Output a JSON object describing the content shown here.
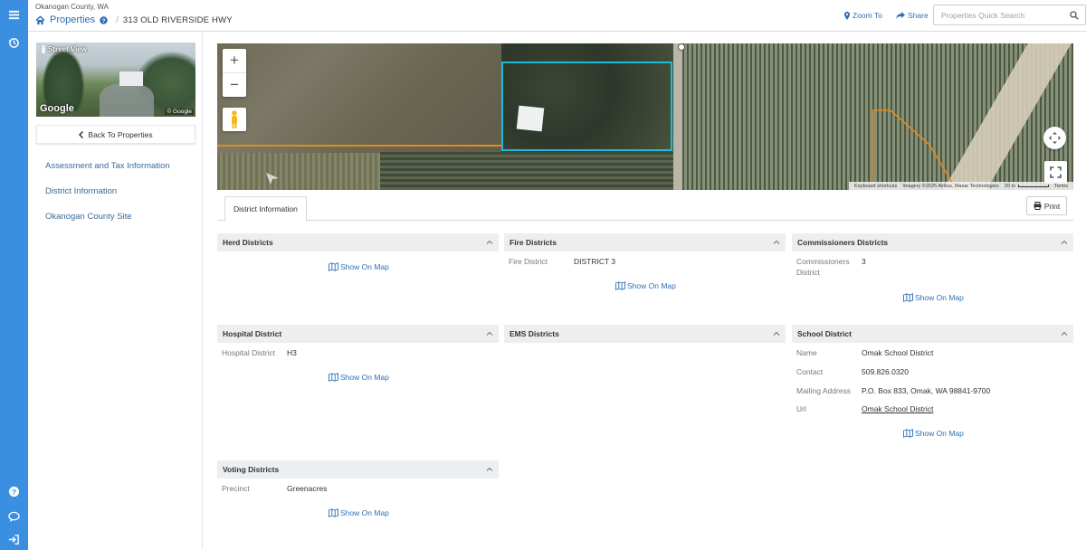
{
  "header": {
    "county": "Okanogan County, WA",
    "breadcrumb_root": "Properties",
    "address": "313 OLD RIVERSIDE HWY",
    "zoom_to": "Zoom To",
    "share": "Share",
    "search_placeholder": "Properties Quick Search"
  },
  "sidebar": {
    "street_view_label": "Street View",
    "street_view_logo": "Google",
    "street_view_copyright": "© Google",
    "back_button": "Back To Properties",
    "nav": [
      "Assessment and Tax Information",
      "District Information",
      "Okanogan County Site"
    ]
  },
  "map": {
    "attribution": {
      "shortcuts": "Keyboard shortcuts",
      "imagery": "Imagery ©2025 Airbus, Maxar Technologies",
      "scale": "20 m",
      "terms": "Terms"
    }
  },
  "tabs": {
    "active": "District Information",
    "print": "Print"
  },
  "show_on_map": "Show On Map",
  "panels": {
    "herd": {
      "title": "Herd Districts"
    },
    "fire": {
      "title": "Fire Districts",
      "rows": [
        {
          "k": "Fire District",
          "v": "DISTRICT 3"
        }
      ]
    },
    "commissioners": {
      "title": "Commissioners Districts",
      "rows": [
        {
          "k": "Commissioners District",
          "v": "3"
        }
      ]
    },
    "hospital": {
      "title": "Hospital District",
      "rows": [
        {
          "k": "Hospital District",
          "v": "H3"
        }
      ]
    },
    "ems": {
      "title": "EMS Districts"
    },
    "school": {
      "title": "School District",
      "rows": [
        {
          "k": "Name",
          "v": "Omak School District"
        },
        {
          "k": "Contact",
          "v": "509.826.0320"
        },
        {
          "k": "Mailing Address",
          "v": "P.O. Box 833, Omak, WA 98841-9700"
        },
        {
          "k": "Url",
          "v": "Omak School District"
        }
      ]
    },
    "voting": {
      "title": "Voting Districts",
      "rows": [
        {
          "k": "Precinct",
          "v": "Greenacres"
        }
      ]
    }
  },
  "colors": {
    "rail": "#3b8fe0",
    "link": "#2f6fb6",
    "parcel": "#1fbad6",
    "boundary": "#e58a1f"
  }
}
